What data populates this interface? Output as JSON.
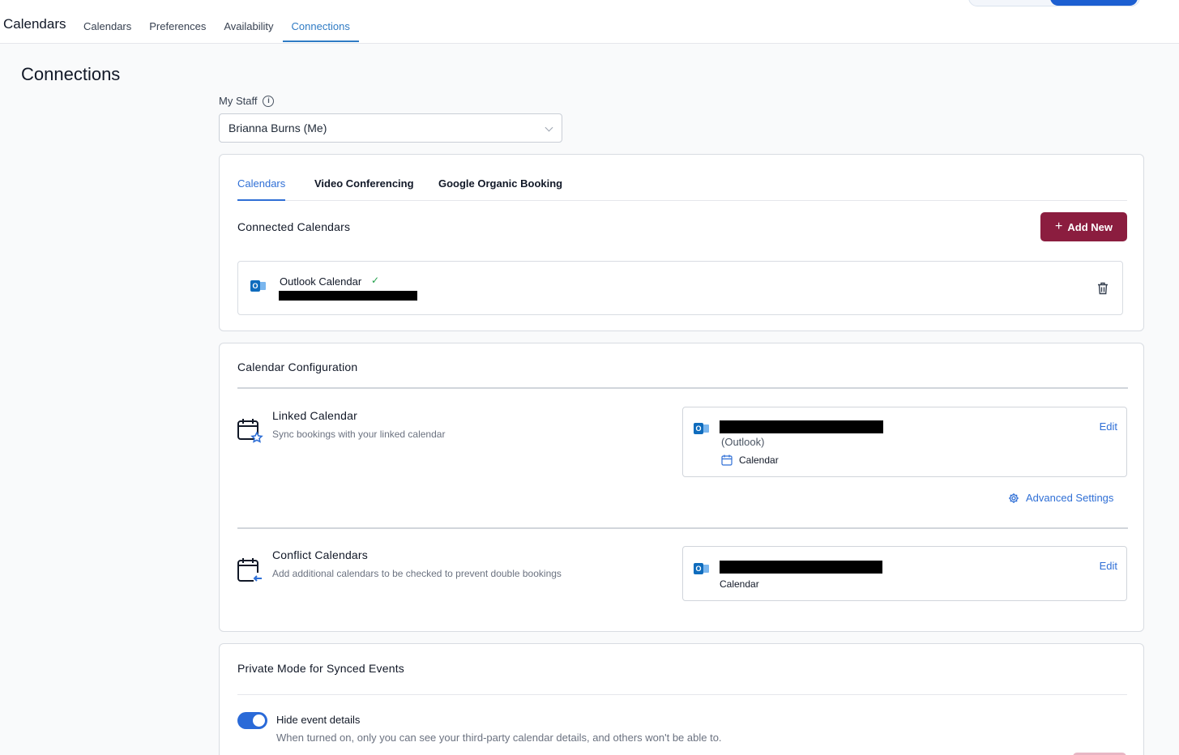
{
  "topbar": {
    "brand": "Calendars",
    "nav": [
      "Calendars",
      "Preferences",
      "Availability",
      "Connections"
    ],
    "active_nav": "Connections"
  },
  "page": {
    "title": "Connections"
  },
  "staff": {
    "label": "My Staff",
    "selected": "Brianna Burns (Me)"
  },
  "tabs": {
    "calendars": "Calendars",
    "video": "Video Conferencing",
    "google": "Google Organic Booking",
    "active": "Calendars"
  },
  "connected": {
    "title": "Connected Calendars",
    "add_button": "Add New",
    "items": [
      {
        "name": "Outlook Calendar",
        "status_icon": "check-icon",
        "account_redacted": true
      }
    ]
  },
  "config": {
    "title": "Calendar Configuration",
    "linked": {
      "title": "Linked Calendar",
      "desc": "Sync bookings with your linked calendar",
      "provider": "(Outlook)",
      "calendar": "Calendar",
      "edit": "Edit",
      "advanced": "Advanced Settings"
    },
    "conflict": {
      "title": "Conflict Calendars",
      "desc": "Add additional calendars to be checked to prevent double bookings",
      "calendar": "Calendar",
      "edit": "Edit"
    }
  },
  "private_mode": {
    "title": "Private Mode for Synced Events",
    "toggle_label": "Hide event details",
    "toggle_on": true,
    "toggle_desc": "When turned on, only you can see your third-party calendar details, and others won't be able to."
  },
  "colors": {
    "accent": "#2f6fd6",
    "add_button": "#8b1d3f",
    "toggle": "#2a6ad8",
    "outlook": "#0f6cbd"
  }
}
